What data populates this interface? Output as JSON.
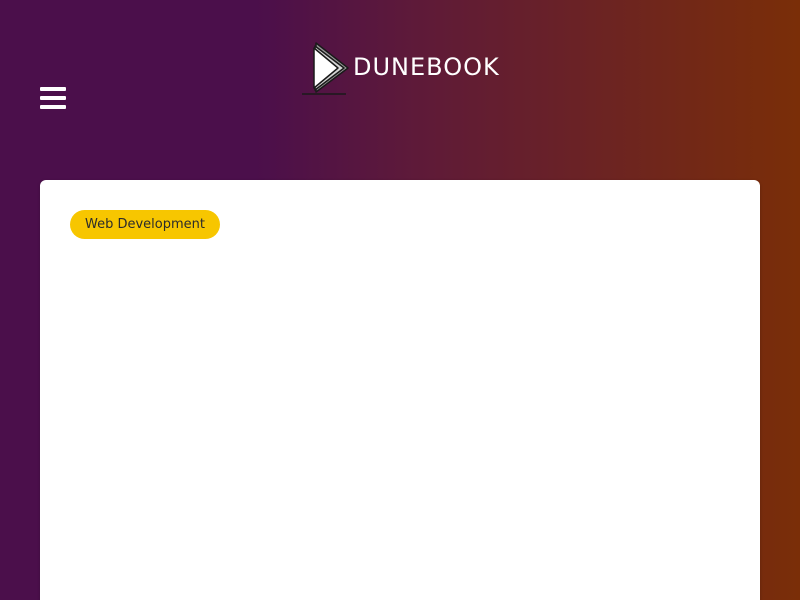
{
  "header": {
    "menu_icon": "hamburger-menu-icon",
    "logo": {
      "icon": "play-book-logo-icon",
      "text": "DUNEBOOK"
    }
  },
  "card": {
    "category_tag": "Web Development"
  },
  "colors": {
    "gradient_start": "#4b0f4b",
    "gradient_end": "#7a2e08",
    "card_background": "#ffffff",
    "tag_background": "#f7c600",
    "tag_text": "#2b2b2b"
  }
}
